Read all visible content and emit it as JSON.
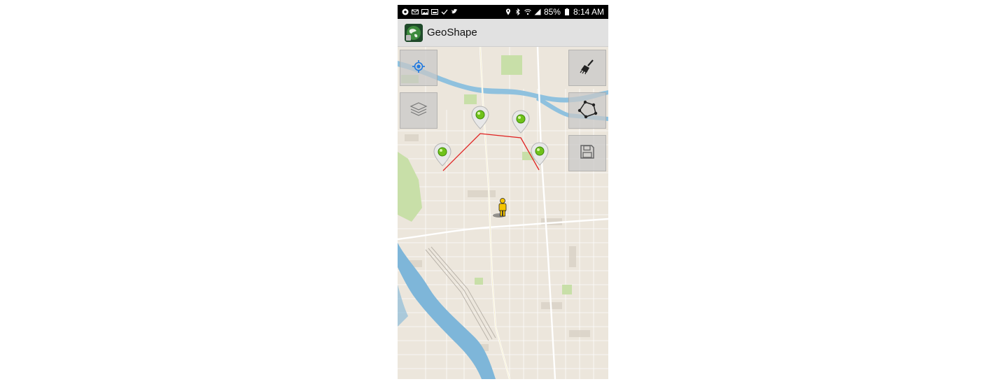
{
  "status_bar": {
    "battery": "85%",
    "time": "8:14 AM",
    "left_icons": [
      "chrome-icon",
      "mail-icon",
      "gallery-icon",
      "image-icon",
      "check-icon",
      "twitter-icon"
    ],
    "right_icons": [
      "location-icon",
      "bluetooth-icon",
      "wifi-icon",
      "signal-icon",
      "battery-icon"
    ]
  },
  "app_bar": {
    "title": "GeoShape",
    "logo_icon": "geoshape-logo-icon"
  },
  "map": {
    "water_color": "#7eb6d9",
    "land_color": "#ece6dc",
    "park_color": "#c8dfa8",
    "polyline_color": "#e02020",
    "markers": [
      {
        "label": "point-1"
      },
      {
        "label": "point-2"
      },
      {
        "label": "point-3"
      },
      {
        "label": "point-4"
      }
    ],
    "user_marker_icon": "pegman-icon"
  },
  "controls": {
    "left": [
      {
        "name": "my-location-button",
        "icon": "crosshair-icon"
      },
      {
        "name": "layers-button",
        "icon": "layers-icon"
      }
    ],
    "right": [
      {
        "name": "clear-button",
        "icon": "broom-icon"
      },
      {
        "name": "draw-polygon-button",
        "icon": "polygon-icon"
      },
      {
        "name": "save-button",
        "icon": "floppy-icon"
      }
    ]
  }
}
